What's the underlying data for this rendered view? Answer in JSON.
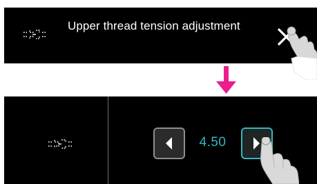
{
  "top_panel": {
    "title": "Upper thread tension adjustment",
    "icons": {
      "stitch": "thread-tension-icon",
      "close": "close-icon",
      "touch": "pointing-hand-icon"
    }
  },
  "transition": {
    "arrow_icon": "down-arrow-icon",
    "arrow_color": "#e91e8c"
  },
  "bottom_panel": {
    "stepper": {
      "value": "4.50",
      "decrease_icon": "left-arrow-icon",
      "increase_icon": "right-arrow-icon",
      "active_border_color": "#35b6bf",
      "inactive_border_color": "#8e8e8e"
    },
    "icons": {
      "stitch": "thread-tension-icon",
      "touch": "pointing-hand-icon"
    }
  },
  "colors": {
    "panel_background": "#000000",
    "text": "#ffffff",
    "value_text": "#35b6bf"
  }
}
